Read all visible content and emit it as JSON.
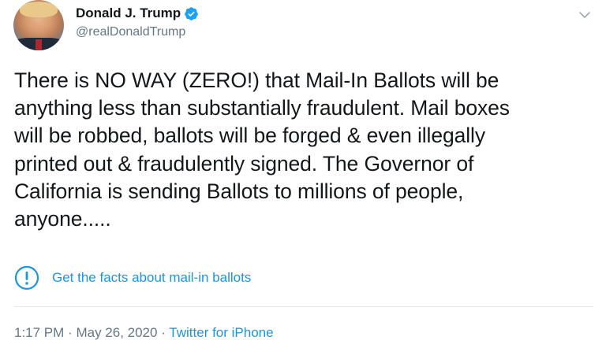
{
  "author": {
    "display_name": "Donald J. Trump",
    "handle": "@realDonaldTrump",
    "verified": true
  },
  "tweet": {
    "text": "There is NO WAY (ZERO!) that Mail-In Ballots will be\nanything less than substantially fraudulent. Mail boxes\nwill be robbed, ballots will be forged & even illegally\nprinted out & fraudulently signed. The Governor of\nCalifornia is sending Ballots to millions of people,\nanyone....."
  },
  "notice": {
    "icon": "exclamation-circle-icon",
    "label": "Get the facts about mail-in ballots"
  },
  "meta": {
    "time": "1:17 PM",
    "separator": "·",
    "date": "May 26, 2020",
    "source": "Twitter for iPhone"
  },
  "colors": {
    "link": "#1b95e0",
    "secondary_text": "#657786",
    "primary_text": "#14171a",
    "verified_badge": "#1da1f2",
    "divider": "#e6ecf0"
  },
  "icons": {
    "menu": "chevron-down-icon",
    "verified": "verified-badge-icon"
  }
}
